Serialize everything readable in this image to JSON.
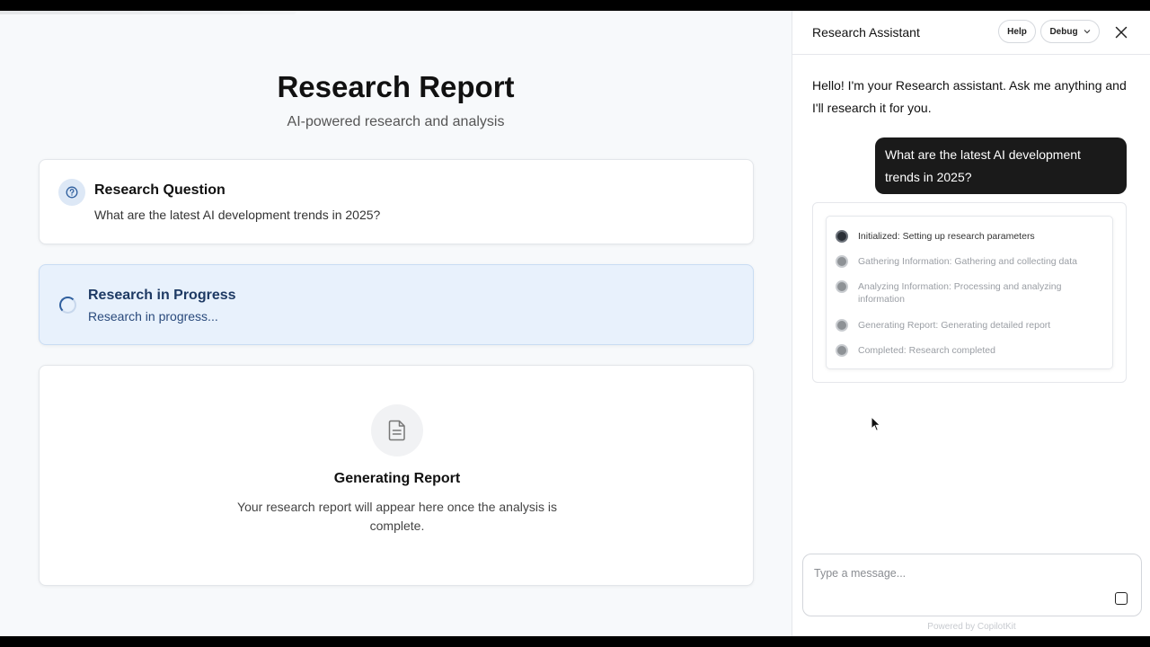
{
  "main": {
    "title": "Research Report",
    "subtitle": "AI-powered research and analysis",
    "question_card": {
      "title": "Research Question",
      "text": "What are the latest AI development trends in 2025?",
      "icon": "question-circle-icon"
    },
    "progress_card": {
      "title": "Research in Progress",
      "text": "Research in progress...",
      "icon": "spinner-icon"
    },
    "report_card": {
      "title": "Generating Report",
      "text": "Your research report will appear here once the analysis is complete.",
      "icon": "document-icon"
    }
  },
  "panel": {
    "title": "Research Assistant",
    "help_label": "Help",
    "debug_label": "Debug",
    "greeting": "Hello! I'm your Research assistant. Ask me anything and I'll research it for you.",
    "user_message": "What are the latest AI development trends in 2025?",
    "steps": [
      {
        "label": "Initialized: Setting up research parameters",
        "active": true
      },
      {
        "label": "Gathering Information: Gathering and collecting data",
        "active": false
      },
      {
        "label": "Analyzing Information: Processing and analyzing information",
        "active": false
      },
      {
        "label": "Generating Report: Generating detailed report",
        "active": false
      },
      {
        "label": "Completed: Research completed",
        "active": false
      }
    ],
    "composer": {
      "placeholder": "Type a message..."
    },
    "powered_by": "Powered by CopilotKit"
  },
  "colors": {
    "accent_blue": "#2f5f9e",
    "progress_bg": "#e8f1fc",
    "user_bubble": "#1a1a1a"
  }
}
